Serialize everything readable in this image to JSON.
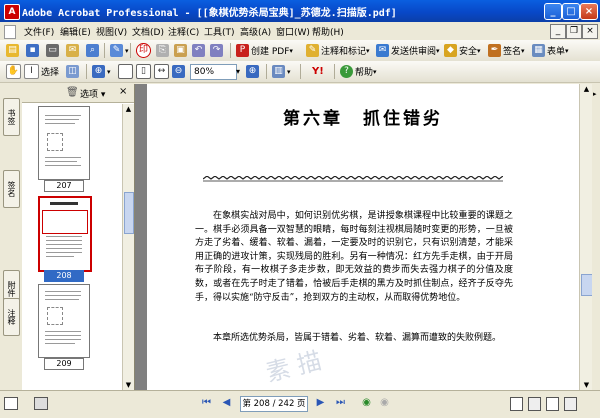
{
  "window": {
    "title": "Adobe Acrobat Professional - [[象棋优势杀局宝典]_苏德龙.扫描版.pdf]",
    "app_icon": "adobe-acrobat-icon"
  },
  "menu": [
    "文件(F)",
    "编辑(E)",
    "视图(V)",
    "文档(D)",
    "注释(C)",
    "工具(T)",
    "高级(A)",
    "窗口(W)",
    "帮助(H)"
  ],
  "toolbar1": {
    "create_pdf": "创建 PDF",
    "comment_markup": "注释和标记",
    "send_review": "发送供审阅",
    "security": "安全",
    "sign": "签名",
    "forms": "表单"
  },
  "toolbar2": {
    "select": "选择",
    "zoom_level": "80%",
    "help": "帮助"
  },
  "panel": {
    "options_label": "选项",
    "tabs": [
      "书签",
      "签名",
      "附件",
      "注释"
    ],
    "thumbnails": [
      {
        "label": "207",
        "selected": false
      },
      {
        "label": "208",
        "selected": true
      },
      {
        "label": "209",
        "selected": false
      }
    ]
  },
  "page": {
    "chapter_title": "第六章　抓住错劣",
    "paragraph1": "在象棋实战对局中，如何识别优劣棋，是讲授象棋课程中比较重要的课题之一。棋手必须具备一双智慧的眼睛，每时每刻注视棋局随时变更的形势，一旦被方走了劣着、缓着、软着、漏着，一定要及时的识别它，只有识别清楚，才能采用正确的进攻计策，实现残局的胜利。另有一种情况：红方先手走棋，由于开局布子阶段，有一枚棋子多走步数，即无效益的费步而失去强力棋子的分值及度数，或者在先子时走了错着，恰被后手走棋的黑方及时抓住制点，经齐子反夺先手，得以实施“防守反击”，抢到双方的主动权，从而取得优势地位。",
    "paragraph2": "本章所选优势杀局，皆属于错着、劣着、软着、漏算而遭致的失败例题。",
    "watermark": "素描"
  },
  "status": {
    "page_display": "第 208 / 242 页",
    "current_page": 208,
    "total_pages": 242
  }
}
